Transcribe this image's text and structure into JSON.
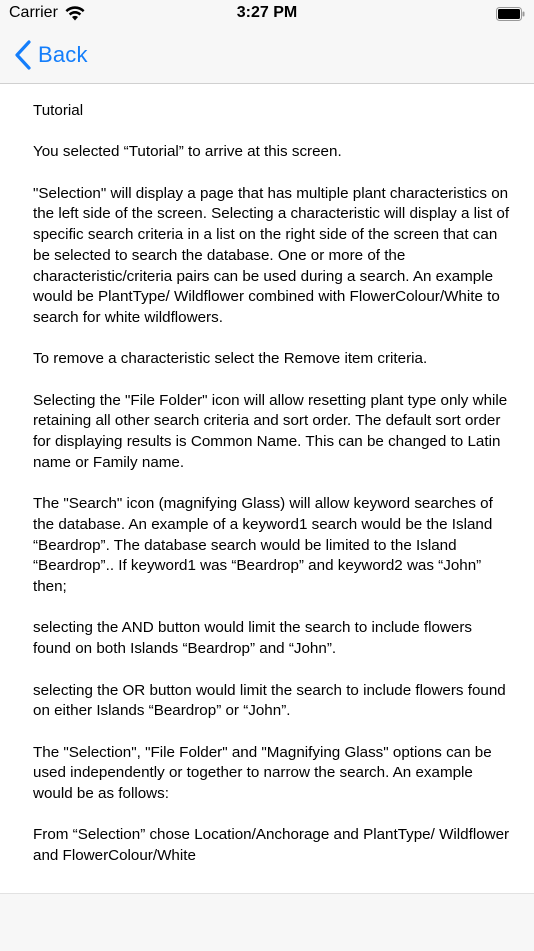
{
  "status_bar": {
    "carrier": "Carrier",
    "time": "3:27 PM",
    "icons": [
      "wifi-icon",
      "battery-icon"
    ]
  },
  "nav_bar": {
    "back_label": "Back",
    "back_icon": "chevron-left-icon",
    "accent_color": "#147efb"
  },
  "content": {
    "paragraphs": [
      "Tutorial",
      "You selected “Tutorial” to arrive at this screen.",
      "\"Selection\" will display a page that has multiple plant characteristics on the left side of the screen. Selecting a characteristic will display a list of specific search criteria in a list on the right side of the screen that can be selected to search the database. One or more of the characteristic/criteria pairs can be used during a search. An example would be  PlantType/ Wildflower combined with FlowerColour/White to search for white wildflowers.",
      "To remove a characteristic select the Remove item criteria.",
      "Selecting the \"File Folder\" icon will allow resetting plant type only while retaining all other search criteria and sort order.   The default sort order for displaying results is Common Name. This can be changed to Latin name or Family name.",
      "The \"Search\" icon (magnifying Glass) will allow keyword searches of the database.   An example of a keyword1 search would be the Island “Beardrop”. The database search would be limited to the Island “Beardrop”.. If keyword1 was “Beardrop” and keyword2 was “John” then;",
      "selecting the AND button would limit the search to include flowers found on both Islands “Beardrop” and “John”.",
      "selecting the OR button would limit the search to include flowers found on either Islands “Beardrop” or “John”.",
      "The \"Selection\", \"File Folder\" and \"Magnifying Glass\" options can be used independently or together to narrow the search. An example would be as follows:",
      "From “Selection” chose   Location/Anchorage and PlantType/ Wildflower and FlowerColour/White"
    ]
  }
}
